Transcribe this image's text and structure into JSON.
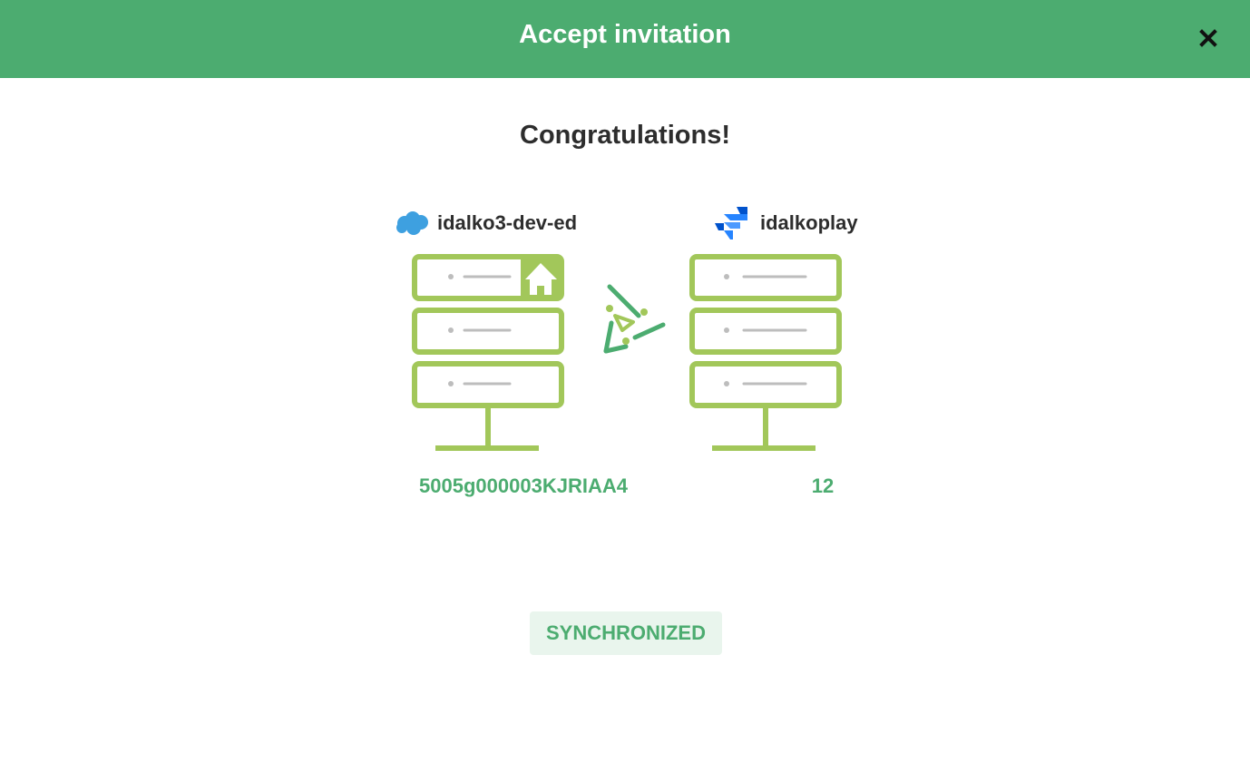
{
  "header": {
    "title": "Accept invitation",
    "close_icon": "close-icon",
    "background_color": "#4cac70"
  },
  "main": {
    "title": "Congratulations!",
    "left_instance": {
      "name": "idalko3-dev-ed",
      "platform_icon": "salesforce-cloud-icon",
      "entity_id": "5005g000003KJRIAA4"
    },
    "right_instance": {
      "name": "idalkoplay",
      "platform_icon": "jira-icon",
      "entity_id": "12"
    },
    "sync_icon": "exalate-sync-icon",
    "status": "SYNCHRONIZED"
  },
  "colors": {
    "accent": "#4cac70",
    "server_green": "#a2c75a",
    "status_background": "#e9f5ed",
    "text_dark": "#2d2d2d"
  }
}
